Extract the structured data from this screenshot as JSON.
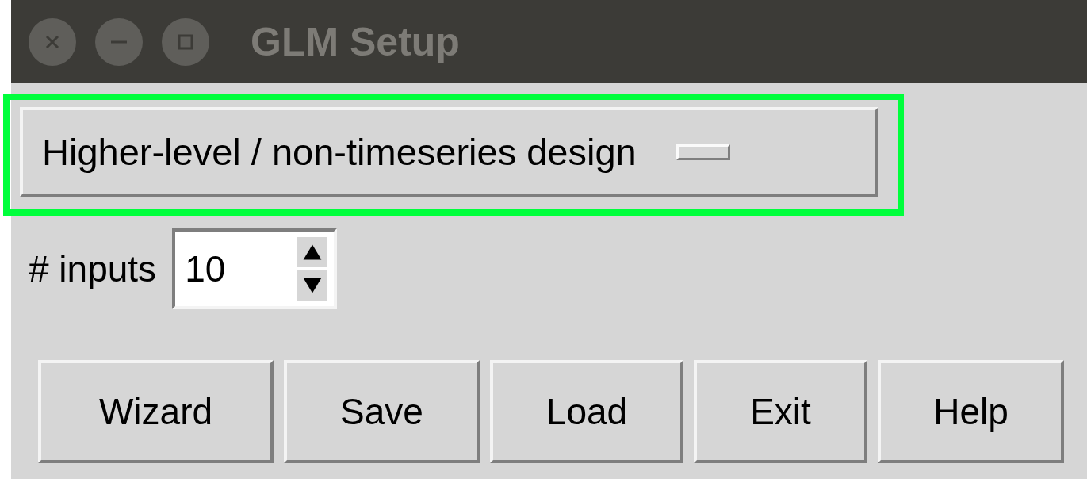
{
  "window": {
    "title": "GLM Setup"
  },
  "design_menu": {
    "value": "Higher-level / non-timeseries design"
  },
  "inputs": {
    "label": "# inputs",
    "value": "10"
  },
  "buttons": [
    "Wizard",
    "Save",
    "Load",
    "Exit",
    "Help"
  ]
}
